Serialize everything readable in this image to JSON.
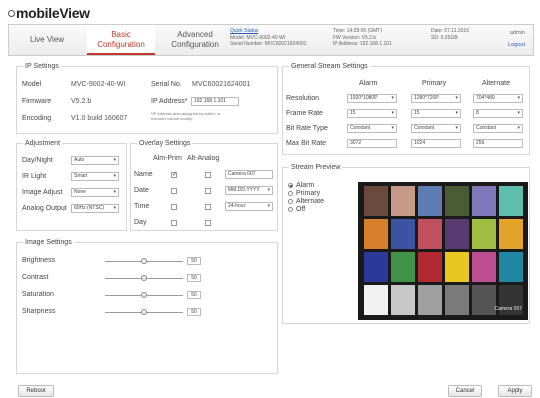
{
  "brand": {
    "logo_text": "mobileView"
  },
  "tabs": [
    {
      "label": "Live View",
      "active": false
    },
    {
      "label": "Basic\nConfiguration",
      "active": true
    },
    {
      "label": "Advanced\nConfiguration",
      "active": false
    }
  ],
  "header_info": {
    "quick_status": "Quick Status",
    "model": "Model: MVC-9002-40-WI",
    "serial": "Serial Number: MVC60021624001",
    "time": "Time: 14:28:06 (GMT)",
    "fw": "FW Version: V5.2.b",
    "ip": "IP Address: 192.168.1.101",
    "date": "Date: 07.11.2016",
    "sd": "SD: 6.25GB",
    "user": "admin",
    "logout": "Logout"
  },
  "ip_settings": {
    "title": "IP Settings",
    "model_label": "Model",
    "model_value": "MVC-9002-40-WI",
    "serial_label": "Serial No.",
    "serial_value": "MVC60021624001",
    "firmware_label": "Firmware",
    "firmware_value": "V5.2.b",
    "ip_label": "IP Address*",
    "ip_value": "192.168.1.101",
    "encoding_label": "Encoding",
    "encoding_value": "V1.0 build 160607",
    "note": "*IP Address auto-assigned by switch or recorder cannot modify."
  },
  "adjustment": {
    "title": "Adjustment",
    "items": [
      {
        "label": "Day/Night",
        "value": "Auto"
      },
      {
        "label": "IR Light",
        "value": "Smart"
      },
      {
        "label": "Image Adjust",
        "value": "None"
      },
      {
        "label": "Analog Output",
        "value": "60Hz (NTSC)"
      }
    ]
  },
  "overlay": {
    "title": "Overlay Settings",
    "col1": "Alm-Prim",
    "col2": "Alt-Analog",
    "rows": [
      {
        "label": "Name",
        "c1": true,
        "c2": false,
        "field": "Camera 007",
        "field_type": "input"
      },
      {
        "label": "Date",
        "c1": false,
        "c2": false,
        "field": "MM.DD.YYYY",
        "field_type": "select"
      },
      {
        "label": "Time",
        "c1": false,
        "c2": false,
        "field": "24-hour",
        "field_type": "select"
      },
      {
        "label": "Day",
        "c1": false,
        "c2": false,
        "field": "",
        "field_type": "none"
      }
    ]
  },
  "image_settings": {
    "title": "Image Settings",
    "items": [
      {
        "label": "Brightness",
        "value": "50",
        "fraction": 0.5
      },
      {
        "label": "Contrast",
        "value": "50",
        "fraction": 0.5
      },
      {
        "label": "Saturation",
        "value": "50",
        "fraction": 0.5
      },
      {
        "label": "Sharpness",
        "value": "50",
        "fraction": 0.5
      }
    ]
  },
  "stream": {
    "title": "General Stream Settings",
    "columns": [
      "Alarm",
      "Primary",
      "Alternate"
    ],
    "rows": [
      {
        "label": "Resolution",
        "values": [
          "1920*1080P",
          "1280*720P",
          "704*480"
        ],
        "type": "select"
      },
      {
        "label": "Frame Rate",
        "values": [
          "15",
          "15",
          "8"
        ],
        "type": "select"
      },
      {
        "label": "Bit Rate Type",
        "values": [
          "Constant",
          "Constant",
          "Constant"
        ],
        "type": "select"
      },
      {
        "label": "Max Bit Rate",
        "values": [
          "3072",
          "1024",
          "256"
        ],
        "type": "input"
      }
    ]
  },
  "preview": {
    "title": "Stream Preview",
    "options": [
      "Alarm",
      "Primary",
      "Alternate",
      "Off"
    ],
    "selected": "Alarm",
    "camera_label": "Camera 007"
  },
  "buttons": {
    "reboot": "Reboot",
    "cancel": "Cancel",
    "apply": "Apply"
  },
  "colors": {
    "accent": "#c0392b",
    "link": "#2a5db0"
  }
}
